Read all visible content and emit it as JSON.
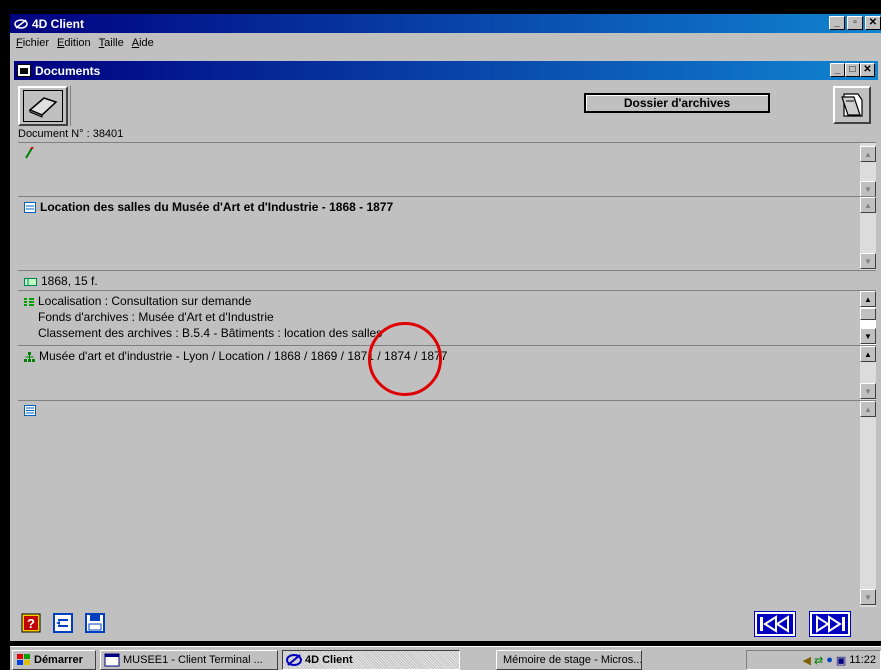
{
  "app": {
    "title": "4D Client",
    "window_buttons": [
      "_",
      "▫",
      "✕"
    ]
  },
  "menu": [
    {
      "label": "Fichier",
      "mnemonic": "F",
      "rest": "ichier"
    },
    {
      "label": "Edition",
      "mnemonic": "E",
      "rest": "dition"
    },
    {
      "label": "Taille",
      "mnemonic": "T",
      "rest": "aille"
    },
    {
      "label": "Aide",
      "mnemonic": "A",
      "rest": "ide"
    }
  ],
  "doc_window": {
    "title": "Documents",
    "buttons": [
      "_",
      "□",
      "✕"
    ]
  },
  "toolbar": {
    "dossier_label": "Dossier d'archives"
  },
  "document": {
    "number_label": "Document N° : 38401",
    "title": "Location des salles du Musée d'Art et d'Industrie - 1868 - 1877",
    "extent": "1868, 15 f.",
    "localisation": "Localisation : Consultation sur demande",
    "fonds": "Fonds d'archives : Musée d'Art et d'Industrie",
    "classement": "Classement des archives : B.5.4 - Bâtiments : location des salles",
    "index_path": "Musée d'art et d'industrie - Lyon / Location / 1868 / 1869 / 1871 / 1874 / 1877"
  },
  "icons": {
    "edit": "pencil-icon",
    "title": "document-lines-icon",
    "extent": "ticket-icon",
    "details": "list-bullets-icon",
    "index": "tree-hierarchy-icon",
    "notes": "note-icon"
  },
  "colors": {
    "titlebar": "#000080",
    "window_bg": "#c0c0c0",
    "highlight_circle": "#e00000",
    "nav_button": "#0000c0"
  },
  "taskbar": {
    "start": "Démarrer",
    "tasks": [
      {
        "label": "MUSEE1 - Client Terminal ...",
        "active": false
      },
      {
        "label": "4D Client",
        "active": true
      },
      {
        "label": "Mémoire de stage - Micros...",
        "active": false
      }
    ],
    "clock": "11:22"
  }
}
